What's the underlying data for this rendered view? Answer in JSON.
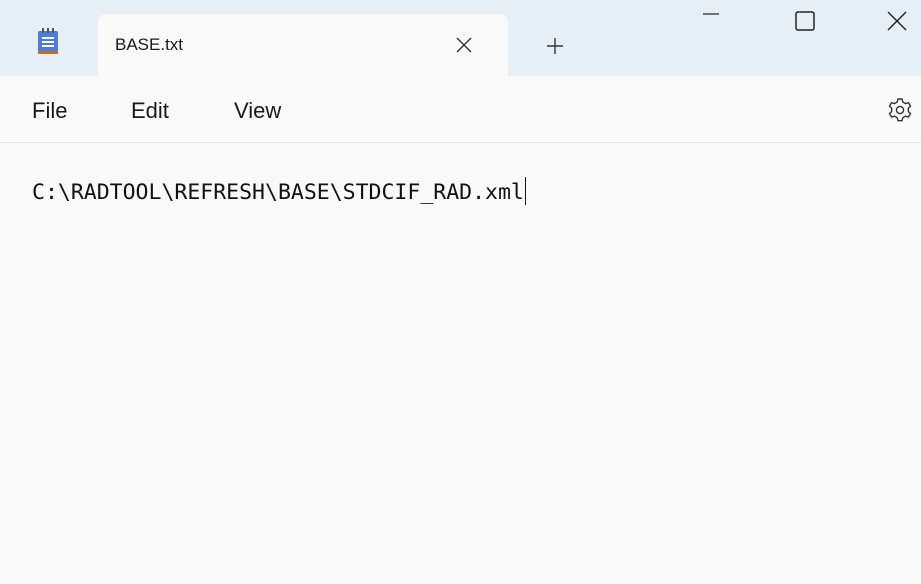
{
  "tab": {
    "title": "BASE.txt"
  },
  "menu": {
    "file": "File",
    "edit": "Edit",
    "view": "View"
  },
  "editor": {
    "content": "C:\\RADTOOL\\REFRESH\\BASE\\STDCIF_RAD.xml"
  },
  "icons": {
    "app": "notepad-icon",
    "tab_close": "close-icon",
    "new_tab": "plus-icon",
    "minimize": "minimize-icon",
    "maximize": "maximize-icon",
    "close": "close-icon",
    "settings": "gear-icon"
  },
  "colors": {
    "titlebar": "#e6eef6",
    "background": "#f9f9f9",
    "app_icon_blue": "#4b7bdc"
  }
}
